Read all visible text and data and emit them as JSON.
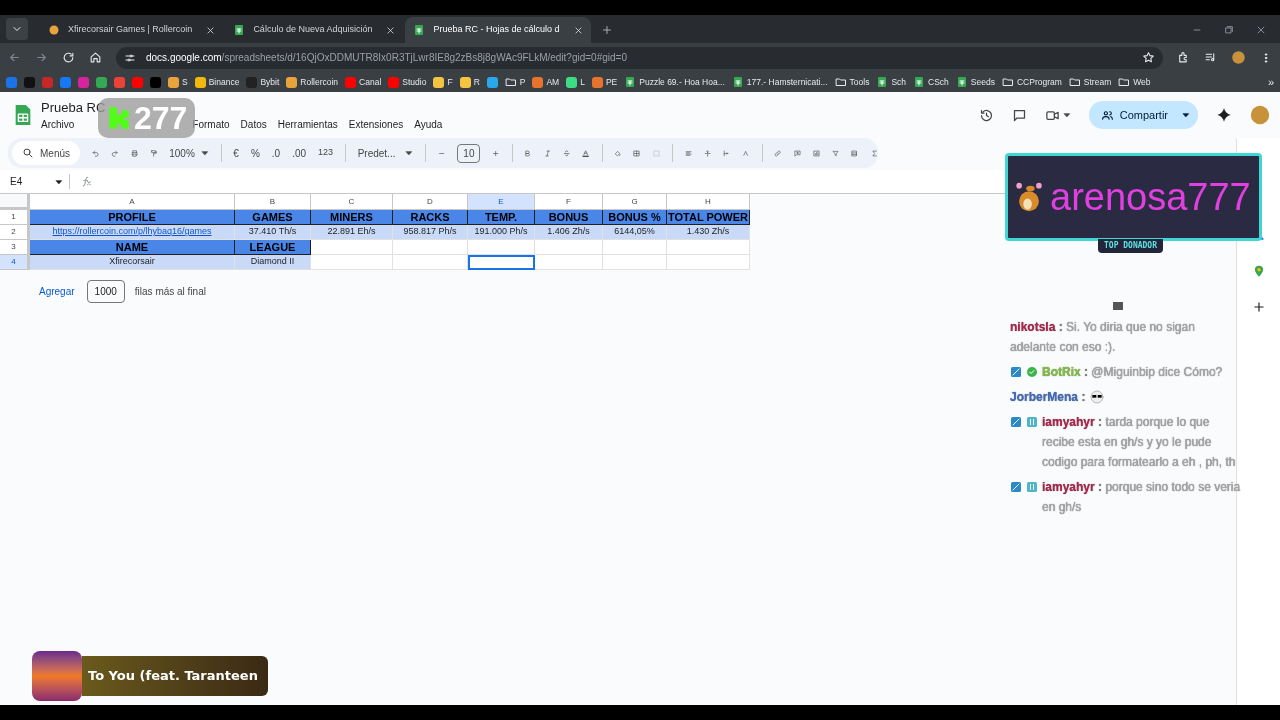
{
  "browser": {
    "tabs": [
      {
        "title": "Xfirecorsair Games | Rollercoin",
        "kind": "site",
        "selected": false
      },
      {
        "title": "Cálculo de Nueva Adquisición",
        "kind": "sheet",
        "selected": false
      },
      {
        "title": "Prueba RC - Hojas de cálculo d",
        "kind": "sheet",
        "selected": true
      }
    ],
    "address": {
      "host": "docs.google.com",
      "path": "/spreadsheets/d/16QjOxDDMUTR8Ix0R3TjLwr8IE8g2zBs8j8gWAc9FLkM/edit?gid=0#gid=0"
    },
    "bookmarks": [
      {
        "kind": "site",
        "color": "#1a73e8"
      },
      {
        "kind": "site",
        "color": "#111111"
      },
      {
        "kind": "site",
        "color": "#c62828"
      },
      {
        "kind": "site",
        "color": "#1877f2"
      },
      {
        "kind": "site",
        "color": "#d6249f"
      },
      {
        "kind": "site",
        "color": "#34a853"
      },
      {
        "kind": "site",
        "color": "#ea4335"
      },
      {
        "kind": "site",
        "color": "#ff0000"
      },
      {
        "kind": "site",
        "color": "#000000"
      },
      {
        "kind": "site",
        "color": "#e8a33d",
        "label": "S"
      },
      {
        "kind": "site",
        "color": "#f0b90b",
        "label": "Binance"
      },
      {
        "kind": "site",
        "color": "#222222",
        "label": "Bybit"
      },
      {
        "kind": "site",
        "color": "#e8a33d",
        "label": "Rollercoin"
      },
      {
        "kind": "site",
        "color": "#ff0000",
        "label": "Canal"
      },
      {
        "kind": "site",
        "color": "#ff0000",
        "label": "Studio"
      },
      {
        "kind": "site",
        "color": "#f5c542",
        "label": "F"
      },
      {
        "kind": "site",
        "color": "#f5c542",
        "label": "R"
      },
      {
        "kind": "site",
        "color": "#29a9eb"
      },
      {
        "kind": "folder",
        "label": "P"
      },
      {
        "kind": "site",
        "color": "#e8732d",
        "label": "AM"
      },
      {
        "kind": "site",
        "color": "#3ddc84",
        "label": "L"
      },
      {
        "kind": "site",
        "color": "#e8732d",
        "label": "PE"
      },
      {
        "kind": "sheet",
        "label": "Puzzle 69.- Hoa Hoa..."
      },
      {
        "kind": "sheet",
        "label": "177.- Hamsternicati..."
      },
      {
        "kind": "folder",
        "label": "Tools"
      },
      {
        "kind": "sheet",
        "label": "Sch"
      },
      {
        "kind": "sheet",
        "label": "CSch"
      },
      {
        "kind": "sheet",
        "label": "Seeds"
      },
      {
        "kind": "folder",
        "label": "CCProgram"
      },
      {
        "kind": "folder",
        "label": "Stream"
      },
      {
        "kind": "folder",
        "label": "Web"
      }
    ],
    "more_bookmarks": "»"
  },
  "sheet": {
    "title": "Prueba RC",
    "menus": [
      "Archivo",
      "Formato",
      "Datos",
      "Herramientas",
      "Extensiones",
      "Ayuda"
    ],
    "share_button": "Compartir",
    "toolbar": {
      "search": "Menús",
      "zoom": "100%",
      "currency": "€",
      "percent": "%",
      "decrease_decimals": ".0",
      "increase_decimals": ".00",
      "number_format": "123",
      "font": "Predet...",
      "font_size": "10"
    },
    "name_box": "E4",
    "columns": [
      "A",
      "B",
      "C",
      "D",
      "E",
      "F",
      "G",
      "H"
    ],
    "rows": [
      {
        "number": "1",
        "cells": [
          {
            "kind": "header",
            "text": "PROFILE",
            "selected": false
          },
          {
            "kind": "header",
            "text": "GAMES",
            "selected": false
          },
          {
            "kind": "header",
            "text": "MINERS",
            "selected": false
          },
          {
            "kind": "header",
            "text": "RACKS",
            "selected": false
          },
          {
            "kind": "header",
            "text": "TEMP.",
            "selected": false
          },
          {
            "kind": "header",
            "text": "BONUS",
            "selected": false
          },
          {
            "kind": "header",
            "text": "BONUS %",
            "selected": false
          },
          {
            "kind": "header",
            "text": "TOTAL POWER",
            "selected": false
          }
        ]
      },
      {
        "number": "2",
        "cells": [
          {
            "kind": "link",
            "text": "https://rollercoin.com/p/lhybaq16/games",
            "selected": false
          },
          {
            "kind": "value",
            "text": "37.410 Th/s",
            "selected": false
          },
          {
            "kind": "value",
            "text": "22.891 Eh/s",
            "selected": false
          },
          {
            "kind": "value",
            "text": "958.817 Ph/s",
            "selected": false
          },
          {
            "kind": "value",
            "text": "191.000 Ph/s",
            "selected": false
          },
          {
            "kind": "value",
            "text": "1.406 Zh/s",
            "selected": false
          },
          {
            "kind": "value",
            "text": "6144,05%",
            "selected": false
          },
          {
            "kind": "value",
            "text": "1.430 Zh/s",
            "selected": false
          }
        ]
      },
      {
        "number": "3",
        "cells": [
          {
            "kind": "header",
            "text": "NAME",
            "selected": false
          },
          {
            "kind": "header",
            "text": "LEAGUE",
            "selected": false
          },
          {
            "kind": "blank",
            "selected": false
          },
          {
            "kind": "blank",
            "selected": false
          },
          {
            "kind": "blank",
            "selected": false
          },
          {
            "kind": "blank",
            "selected": false
          },
          {
            "kind": "blank",
            "selected": false
          },
          {
            "kind": "blank",
            "selected": false
          }
        ]
      },
      {
        "number": "4",
        "cells": [
          {
            "kind": "value",
            "text": "Xfirecorsair",
            "selected": false
          },
          {
            "kind": "value",
            "text": "Diamond II",
            "selected": false
          },
          {
            "kind": "blank",
            "selected": false
          },
          {
            "kind": "blank",
            "selected": false
          },
          {
            "kind": "blank",
            "selected": true
          },
          {
            "kind": "blank",
            "selected": false
          },
          {
            "kind": "blank",
            "selected": false
          },
          {
            "kind": "blank",
            "selected": false
          }
        ]
      }
    ],
    "add_rows": {
      "button": "Agregar",
      "value": "1000",
      "suffix": "filas más al final"
    }
  },
  "stream": {
    "counter": "277",
    "donor": {
      "name": "arenosa777",
      "badge": "TOP DONADOR"
    },
    "chat": [
      {
        "user": "nikotsla",
        "color": "#b0224a",
        "mod": false,
        "verified": false,
        "subscriber": false,
        "separator": ":",
        "text": "Si. Yo diria que no sigan adelante con eso :).",
        "emote": false
      },
      {
        "user": "BotRix",
        "color": "#7ec13a",
        "mod": true,
        "verified": true,
        "subscriber": false,
        "separator": ":",
        "text": "@Miguinbip dice Cómo?",
        "emote": false
      },
      {
        "user": "JorberMena",
        "color": "#3f6bbf",
        "mod": false,
        "verified": false,
        "subscriber": false,
        "separator": ":",
        "emote": true
      },
      {
        "user": "iamyahyr",
        "color": "#b0224a",
        "mod": true,
        "verified": false,
        "subscriber": true,
        "separator": ":",
        "text": "tarda porque lo que recibe esta en gh/s y yo le pude codigo para formatearlo a eh , ph, th",
        "emote": false
      },
      {
        "user": "iamyahyr",
        "color": "#b0224a",
        "mod": true,
        "verified": false,
        "subscriber": true,
        "separator": ":",
        "text": "porque sino todo se veria en gh/s",
        "emote": false
      }
    ],
    "song": "To You (feat. Taranteen"
  }
}
